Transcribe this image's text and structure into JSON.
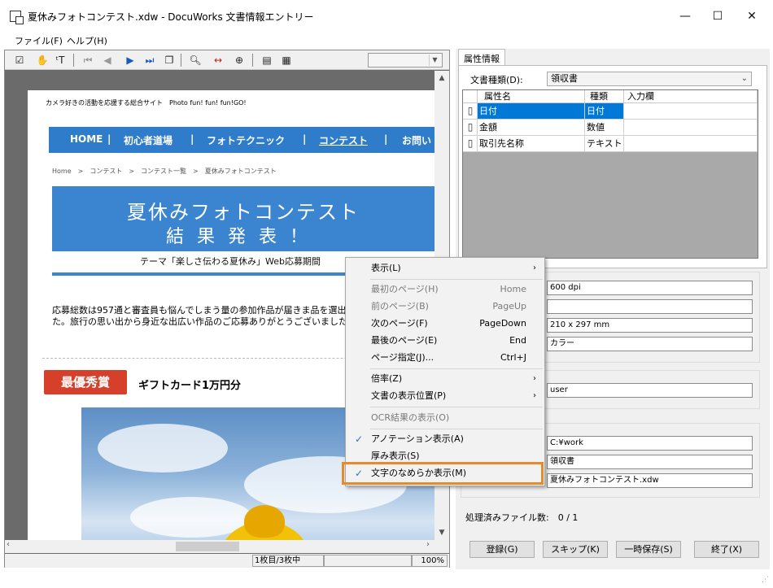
{
  "window": {
    "title": "夏休みフォトコンテスト.xdw - DocuWorks 文書情報エントリー",
    "min": "—",
    "max": "☐",
    "close": "✕"
  },
  "menubar": {
    "file": "ファイル(F)",
    "help": "ヘルプ(H)"
  },
  "viewer": {
    "page_header": "カメラ好きの活動を応援する総合サイト　Photo fun! fun! fun!GO!",
    "nav": [
      "HOME",
      "|",
      "初心者道場",
      "|",
      "フォトテクニック",
      "|",
      "コンテスト",
      "|",
      "お問い"
    ],
    "breadcrumb": "Home　>　コンテスト　>　コンテスト一覧　>　夏休みフォトコンテスト",
    "hero_title": "夏休みフォトコンテスト",
    "hero_sub": "結果発表！",
    "hero_caption": "テーマ「楽しさ伝わる夏休み」Web応募期間",
    "body_text": "応募総数は957通と審査員も悩んでしまう量の参加作品が届きま品を選出させていただきました。旅行の思い出から身近な出広い作品のご応募ありがとうございました。",
    "award_badge": "最優秀賞",
    "award_text": "ギフトカード1万円分"
  },
  "status": {
    "page": "1枚目/3枚中",
    "zoom": "100%"
  },
  "context_menu": {
    "items": [
      {
        "label": "表示(L)",
        "accel": "",
        "submenu": true,
        "disabled": false,
        "checked": false
      },
      {
        "label": "最初のページ(H)",
        "accel": "Home",
        "disabled": true,
        "checked": false
      },
      {
        "label": "前のページ(B)",
        "accel": "PageUp",
        "disabled": true,
        "checked": false
      },
      {
        "label": "次のページ(F)",
        "accel": "PageDown",
        "disabled": false,
        "checked": false
      },
      {
        "label": "最後のページ(E)",
        "accel": "End",
        "disabled": false,
        "checked": false
      },
      {
        "label": "ページ指定(J)...",
        "accel": "Ctrl+J",
        "disabled": false,
        "checked": false
      },
      {
        "label": "倍率(Z)",
        "accel": "",
        "submenu": true,
        "disabled": false,
        "checked": false
      },
      {
        "label": "文書の表示位置(P)",
        "accel": "",
        "submenu": true,
        "disabled": false,
        "checked": false
      },
      {
        "label": "OCR結果の表示(O)",
        "accel": "",
        "disabled": true,
        "checked": false
      },
      {
        "label": "アノテーション表示(A)",
        "accel": "",
        "disabled": false,
        "checked": true
      },
      {
        "label": "厚み表示(S)",
        "accel": "",
        "disabled": false,
        "checked": false
      },
      {
        "label": "文字のなめらか表示(M)",
        "accel": "",
        "disabled": false,
        "checked": true
      }
    ],
    "highlight_color": "#e68a2e"
  },
  "properties": {
    "tab": "属性情報",
    "doctype_label": "文書種類(D):",
    "doctype_value": "領収書",
    "columns": [
      "属性名",
      "種類",
      "入力欄"
    ],
    "rows": [
      {
        "name": "日付",
        "type": "日付",
        "value": ""
      },
      {
        "name": "金額",
        "type": "数値",
        "value": ""
      },
      {
        "name": "取引先名称",
        "type": "テキスト",
        "value": ""
      }
    ]
  },
  "fields": {
    "resolution": "600 dpi",
    "blank": "",
    "size": "210 x 297 mm",
    "color": "カラー",
    "user": "user",
    "folder": "C:¥work",
    "doc_name": "領収書",
    "file_name": "夏休みフォトコンテスト.xdw"
  },
  "processed": "処理済みファイル数:　0 / 1",
  "buttons": {
    "register": "登録(G)",
    "skip": "スキップ(K)",
    "save_temp": "一時保存(S)",
    "finish": "終了(X)"
  },
  "colors": {
    "accent": "#0078d7",
    "nav_blue": "#2f7ccb",
    "award_red": "#d6402a"
  }
}
